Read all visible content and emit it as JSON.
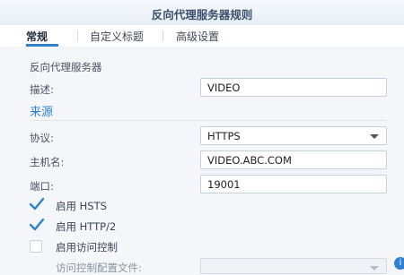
{
  "window": {
    "title": "反向代理服务器规则"
  },
  "tabs": [
    {
      "label": "常规",
      "active": true
    },
    {
      "label": "自定义标题",
      "active": false
    },
    {
      "label": "高级设置",
      "active": false
    }
  ],
  "general": {
    "heading": "反向代理服务器",
    "description_label": "描述:",
    "description_value": "VIDEO"
  },
  "source": {
    "heading": "来源",
    "protocol_label": "协议:",
    "protocol_value": "HTTPS",
    "hostname_label": "主机名:",
    "hostname_value": "VIDEO.ABC.COM",
    "port_label": "端口:",
    "port_value": "19001"
  },
  "options": [
    {
      "label": "启用 HSTS",
      "checked": true
    },
    {
      "label": "启用 HTTP/2",
      "checked": true
    },
    {
      "label": "启用访问控制",
      "checked": false
    }
  ],
  "access_profile": {
    "label": "访问控制配置文件:"
  },
  "colors": {
    "accent": "#2f80d1",
    "title": "#3a4f6b",
    "background": "#f4f6f9"
  }
}
